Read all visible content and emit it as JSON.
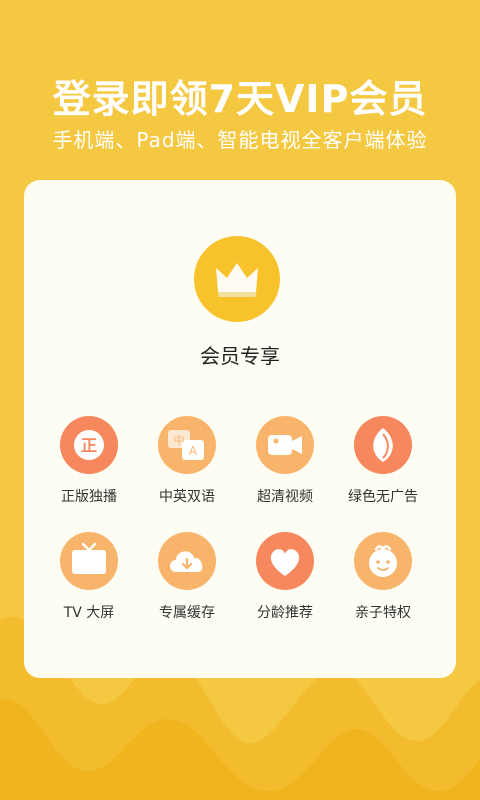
{
  "header": {
    "headline": "登录即领7天VIP会员",
    "subline": "手机端、Pad端、智能电视全客户端体验"
  },
  "member": {
    "title": "会员专享"
  },
  "features": [
    {
      "label": "正版独播",
      "icon": "zheng-badge-icon",
      "glyph": "正"
    },
    {
      "label": "中英双语",
      "icon": "bilingual-icon",
      "glyph_cn": "中",
      "glyph_en": "A"
    },
    {
      "label": "超清视频",
      "icon": "video-camera-icon"
    },
    {
      "label": "绿色无广告",
      "icon": "leaf-icon"
    },
    {
      "label": "TV 大屏",
      "icon": "tv-icon"
    },
    {
      "label": "专属缓存",
      "icon": "cloud-download-icon"
    },
    {
      "label": "分龄推荐",
      "icon": "heart-icon"
    },
    {
      "label": "亲子特权",
      "icon": "baby-face-icon"
    }
  ],
  "colors": {
    "background": "#F5C842",
    "card": "#FEFDF3",
    "crown_circle": "#F8C22A",
    "orange": "#F7875C",
    "apricot": "#F8B46A"
  }
}
